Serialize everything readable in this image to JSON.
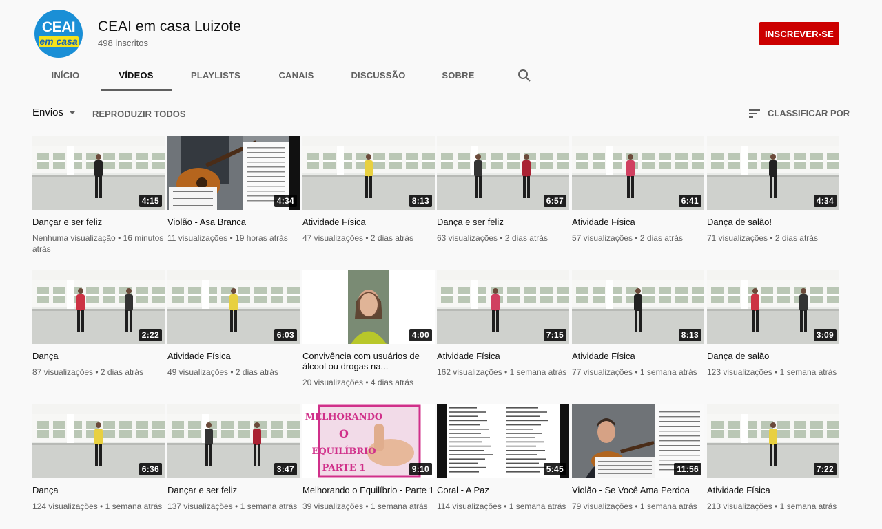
{
  "channel": {
    "logo_text_top": "CEAI",
    "logo_text_bottom": "em casa",
    "name": "CEAI em casa Luizote",
    "subscribers": "498 inscritos",
    "subscribe_label": "INSCREVER-SE"
  },
  "tabs": [
    {
      "label": "INÍCIO"
    },
    {
      "label": "VÍDEOS",
      "active": true
    },
    {
      "label": "PLAYLISTS"
    },
    {
      "label": "CANAIS"
    },
    {
      "label": "DISCUSSÃO"
    },
    {
      "label": "SOBRE"
    }
  ],
  "toolbar": {
    "sort_label": "Envios",
    "play_all": "REPRODUZIR TODOS",
    "sort_by": "CLASSIFICAR POR"
  },
  "videos": [
    {
      "title": "Dançar e ser feliz",
      "meta": "Nenhuma visualização • 16 minutos atrás",
      "duration": "4:15",
      "thumb": "dance-hall"
    },
    {
      "title": "Violão - Asa Branca",
      "meta": "11 visualizações • 19 horas atrás",
      "duration": "4:34",
      "thumb": "guitar-sheet"
    },
    {
      "title": "Atividade Física",
      "meta": "47 visualizações • 2 dias atrás",
      "duration": "8:13",
      "thumb": "dance-hall"
    },
    {
      "title": "Dança e ser feliz",
      "meta": "63 visualizações • 2 dias atrás",
      "duration": "6:57",
      "thumb": "dance-hall"
    },
    {
      "title": "Atividade Física",
      "meta": "57 visualizações • 2 dias atrás",
      "duration": "6:41",
      "thumb": "dance-hall"
    },
    {
      "title": "Dança de salão!",
      "meta": "71 visualizações • 2 dias atrás",
      "duration": "4:34",
      "thumb": "dance-hall"
    },
    {
      "title": "Dança",
      "meta": "87 visualizações • 2 dias atrás",
      "duration": "2:22",
      "thumb": "dance-hall"
    },
    {
      "title": "Atividade Física",
      "meta": "49 visualizações • 2 dias atrás",
      "duration": "6:03",
      "thumb": "dance-hall"
    },
    {
      "title": "Convivência com usuários de álcool ou drogas na...",
      "meta": "20 visualizações • 4 dias atrás",
      "duration": "4:00",
      "thumb": "portrait"
    },
    {
      "title": "Atividade Física",
      "meta": "162 visualizações • 1 semana atrás",
      "duration": "7:15",
      "thumb": "dance-hall"
    },
    {
      "title": "Atividade Física",
      "meta": "77 visualizações • 1 semana atrás",
      "duration": "8:13",
      "thumb": "dance-hall"
    },
    {
      "title": "Dança de salão",
      "meta": "123 visualizações • 1 semana atrás",
      "duration": "3:09",
      "thumb": "dance-hall"
    },
    {
      "title": "Dança",
      "meta": "124 visualizações • 1 semana atrás",
      "duration": "6:36",
      "thumb": "dance-hall"
    },
    {
      "title": "Dançar e ser feliz",
      "meta": "137 visualizações • 1 semana atrás",
      "duration": "3:47",
      "thumb": "dance-hall"
    },
    {
      "title": "Melhorando o Equilíbrio - Parte 1",
      "meta": "39 visualizações • 1 semana atrás",
      "duration": "9:10",
      "thumb": "pink-title",
      "thumb_lines": [
        "MELHORANDO",
        "O",
        "EQUILÍBRIO",
        "PARTE 1"
      ]
    },
    {
      "title": "Coral - A Paz",
      "meta": "114 visualizações • 1 semana atrás",
      "duration": "5:45",
      "thumb": "lyrics"
    },
    {
      "title": "Violão - Se Você Ama Perdoa",
      "meta": "79 visualizações • 1 semana atrás",
      "duration": "11:56",
      "thumb": "guitar-man"
    },
    {
      "title": "Atividade Física",
      "meta": "213 visualizações • 1 semana atrás",
      "duration": "7:22",
      "thumb": "dance-hall"
    }
  ],
  "colors": {
    "accent_red": "#cc0000",
    "text_secondary": "#606060"
  }
}
